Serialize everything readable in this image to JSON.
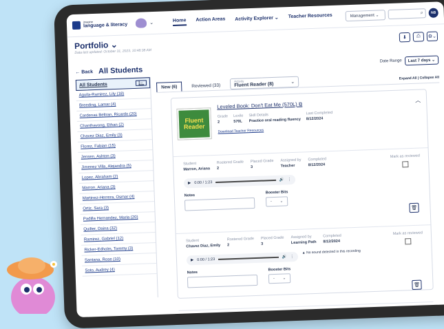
{
  "app": {
    "logo_small": "imagine",
    "logo_name": "language & literacy"
  },
  "nav": {
    "home": "Home",
    "action_areas": "Action Areas",
    "activity_explorer": "Activity Explorer ⌄",
    "teacher_resources": "Teacher Resources"
  },
  "mgmt": {
    "label": "Management ⌄",
    "avatar": "NB"
  },
  "page": {
    "title": "Portfolio ⌄",
    "updated": "Data last updated: October 31, 2023, 10:48:38 AM",
    "back": "← Back",
    "section": "All Students",
    "date_label": "Date Range",
    "date_value": "Last 7 days ⌄"
  },
  "sidebar": {
    "head": "All Students",
    "collapse": "|←",
    "items": [
      "Aguila-Ramirez, Lily (18)",
      "Breeding, Lamar (4)",
      "Cardenas Beltran, Ricardo (20)",
      "Chanthavong, Ethan (2)",
      "Chavez Diaz, Emily (3)",
      "Florez, Fabian (15)",
      "Jensen, Ashton (3)",
      "Jimenez Villa, Alejandra (5)",
      "Lopez, Abraham (2)",
      "Marron, Ariana (3)",
      "Martinez-Herrera, Osmar (4)",
      "Ortiz, Sara (3)",
      "Padilla Hernandez, Maria (20)",
      "Quilter, Daina (32)",
      "Ramirez, Gabriel (12)",
      "Ricker-Edholm, Tommy (3)",
      "Santana, Rose (10)",
      "Soto, Audrey (4)"
    ]
  },
  "tabs": {
    "new": "New (6)",
    "reviewed": "Reviewed (33)",
    "activity_label": "Activity",
    "activity_value": "Fluent Reader (8)",
    "expand": "Expand All  |  Collapse All"
  },
  "book": {
    "cover": "Fluent Reader",
    "title": "Leveled Book: Don't Eat Me (570L) ⧉",
    "grade_l": "Grade",
    "grade": "2",
    "lexile_l": "Lexile",
    "lexile": "570L",
    "skill_l": "Skill Details",
    "skill": "Practice oral reading fluency",
    "last_l": "Last Completed",
    "last": "8/12/2024",
    "download": "Download Teacher Resources"
  },
  "records": [
    {
      "student": "Marron, Ariana",
      "rostered": "2",
      "placed": "3",
      "assigned": "Teacher",
      "completed": "8/12/2024",
      "time": "0:00 / 1:23",
      "warn": ""
    },
    {
      "student": "Chavez Diaz, Emily",
      "rostered": "2",
      "placed": "3",
      "assigned": "Learning Path",
      "completed": "8/12/2024",
      "time": "0:00 / 1:23",
      "warn": "▲ No sound detected in this recording"
    }
  ],
  "labels": {
    "student": "Student",
    "rostered": "Rostered Grade",
    "placed": "Placed Grade",
    "assigned": "Assigned by",
    "completed": "Completed",
    "mark": "Mark as reviewed",
    "notes": "Notes",
    "booster": "Booster Bits",
    "booster_val": "-"
  }
}
